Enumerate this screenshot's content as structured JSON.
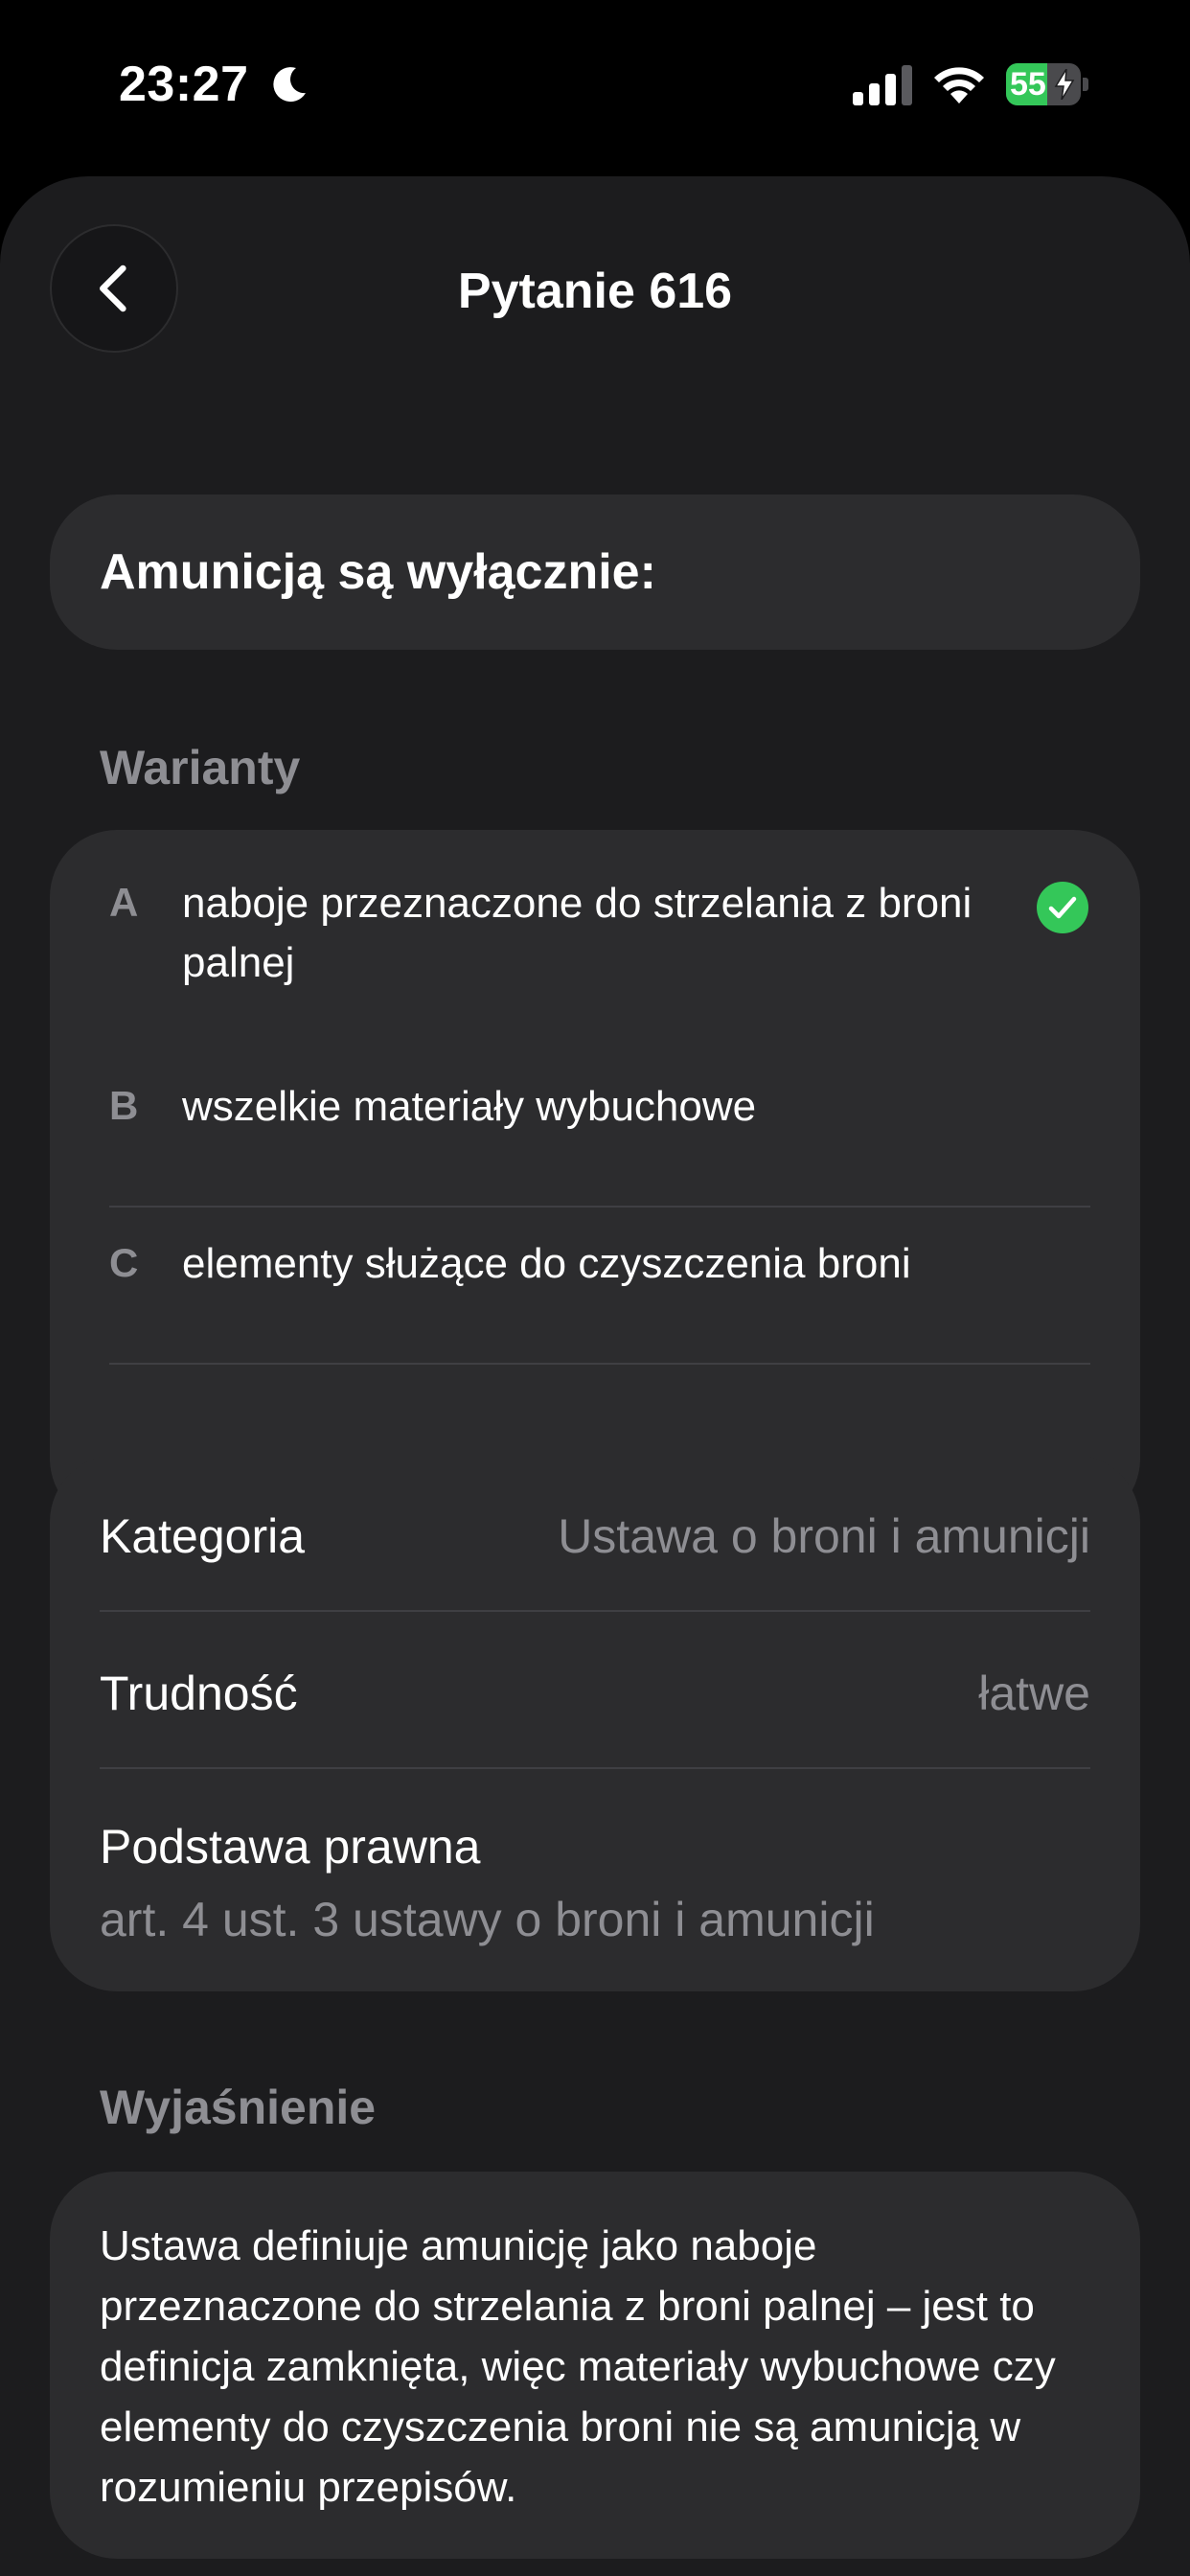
{
  "status_bar": {
    "time": "23:27",
    "battery_level": "55",
    "battery_fraction": 0.55,
    "icons": [
      "moon-icon",
      "signal-icon",
      "wifi-icon",
      "battery-icon"
    ]
  },
  "header": {
    "title": "Pytanie 616",
    "back_icon": "chevron-left-icon"
  },
  "question": {
    "text": "Amunicją są wyłącznie:"
  },
  "options_section": {
    "title": "Warianty",
    "options": [
      {
        "letter": "A",
        "text": "naboje przeznaczone do strzelania z broni palnej",
        "correct": true
      },
      {
        "letter": "B",
        "text": "wszelkie materiały wybuchowe",
        "correct": false
      },
      {
        "letter": "C",
        "text": "elementy służące do czyszczenia broni",
        "correct": false
      }
    ]
  },
  "info": {
    "category_label": "Kategoria",
    "category_value": "Ustawa o broni i amunicji",
    "difficulty_label": "Trudność",
    "difficulty_value": "łatwe",
    "legal_basis_label": "Podstawa prawna",
    "legal_basis_value": "art. 4 ust. 3 ustawy o broni i amunicji"
  },
  "explanation": {
    "title": "Wyjaśnienie",
    "text": "Ustawa definiuje amunicję jako naboje przeznaczone do strzelania z broni palnej – jest to definicja zamknięta, więc materiały wybuchowe czy elementy do czyszczenia broni nie są amunicją w rozumieniu przepisów."
  },
  "colors": {
    "background": "#000000",
    "sheet": "#1c1c1e",
    "card": "#2c2c2e",
    "secondary_text": "#8e8e93",
    "success": "#34c759"
  }
}
